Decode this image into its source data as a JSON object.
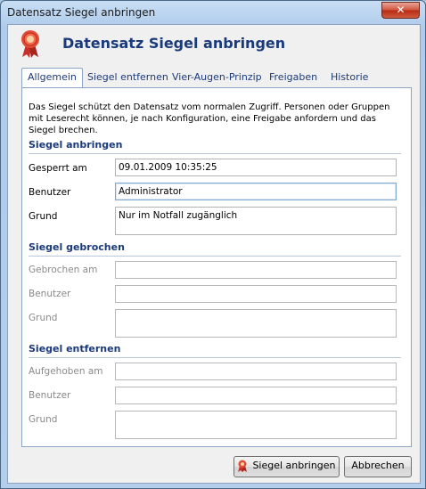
{
  "window": {
    "title": "Datensatz Siegel anbringen",
    "close_glyph": "✕"
  },
  "header": {
    "title": "Datensatz Siegel anbringen",
    "icon": "seal-ribbon-icon",
    "accent": "#c8312a"
  },
  "tabs": [
    {
      "label": "Allgemein",
      "active": true
    },
    {
      "label": "Siegel entfernen"
    },
    {
      "label": "Vier-Augen-Prinzip"
    },
    {
      "label": "Freigaben"
    },
    {
      "label": "Historie"
    }
  ],
  "intro": "Das Siegel schützt den Datensatz vom normalen Zugriff. Personen oder Gruppen mit Leserecht können, je nach Konfiguration, eine Freigabe anfordern und das Siegel brechen.",
  "siegel_anbringen": {
    "title": "Siegel anbringen",
    "gesperrt_label": "Gesperrt am",
    "gesperrt_value": "09.01.2009 10:35:25",
    "benutzer_label": "Benutzer",
    "benutzer_value": "Administrator",
    "grund_label": "Grund",
    "grund_value": "Nur im Notfall zugänglich"
  },
  "siegel_gebrochen": {
    "title": "Siegel gebrochen",
    "gebrochen_label": "Gebrochen am",
    "gebrochen_value": "",
    "benutzer_label": "Benutzer",
    "benutzer_value": "",
    "grund_label": "Grund",
    "grund_value": ""
  },
  "siegel_entfernen": {
    "title": "Siegel entfernen",
    "aufgehoben_label": "Aufgehoben am",
    "aufgehoben_value": "",
    "benutzer_label": "Benutzer",
    "benutzer_value": "",
    "grund_label": "Grund",
    "grund_value": ""
  },
  "buttons": {
    "apply_label": "Siegel anbringen",
    "cancel_label": "Abbrechen"
  }
}
